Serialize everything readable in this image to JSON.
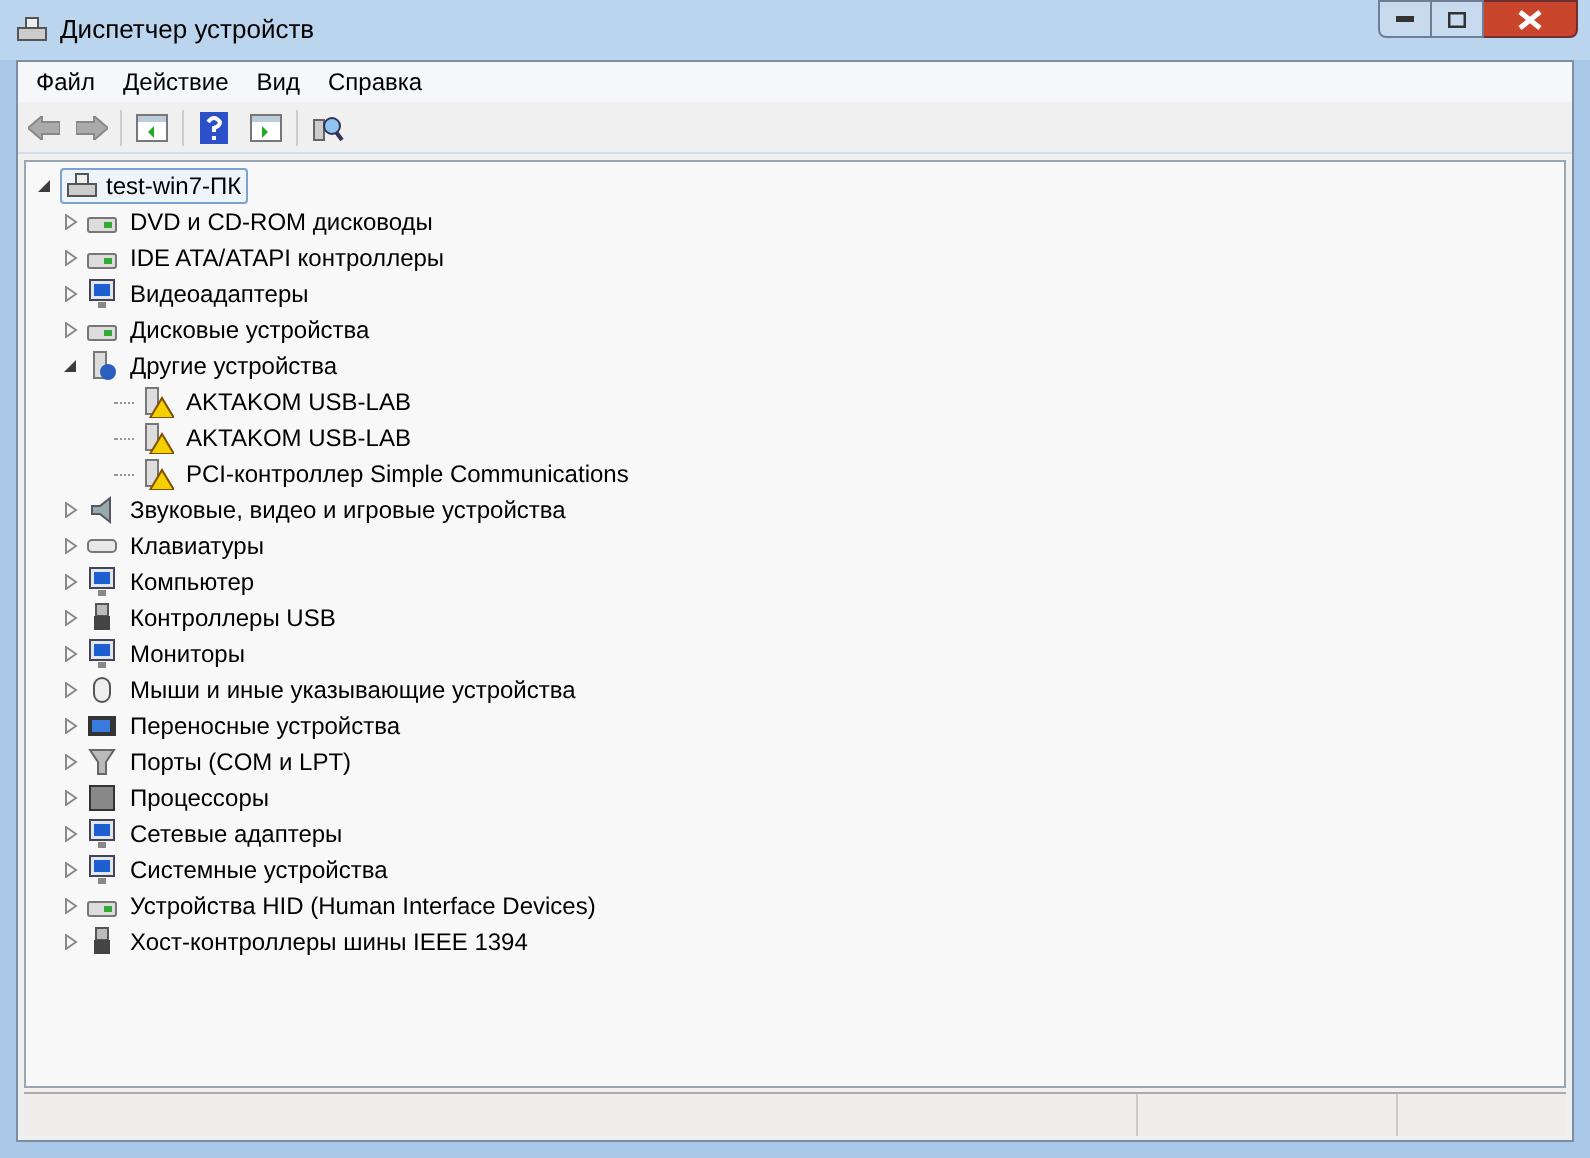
{
  "window": {
    "title": "Диспетчер устройств"
  },
  "menu": [
    {
      "label": "Файл"
    },
    {
      "label": "Действие"
    },
    {
      "label": "Вид"
    },
    {
      "label": "Справка"
    }
  ],
  "tree": {
    "root": {
      "label": "test-win7-ПК",
      "expanded": true,
      "selected": true
    },
    "categories": [
      {
        "label": "DVD и CD-ROM дисководы",
        "expanded": false
      },
      {
        "label": "IDE ATA/ATAPI контроллеры",
        "expanded": false
      },
      {
        "label": "Видеоадаптеры",
        "expanded": false
      },
      {
        "label": "Дисковые устройства",
        "expanded": false
      },
      {
        "label": "Другие устройства",
        "expanded": true,
        "children": [
          {
            "label": "AKTAKOM USB-LAB",
            "warning": true
          },
          {
            "label": "AKTAKOM USB-LAB",
            "warning": true
          },
          {
            "label": "PCI-контроллер Simple Communications",
            "warning": true
          }
        ]
      },
      {
        "label": "Звуковые, видео и игровые устройства",
        "expanded": false
      },
      {
        "label": "Клавиатуры",
        "expanded": false
      },
      {
        "label": "Компьютер",
        "expanded": false
      },
      {
        "label": "Контроллеры USB",
        "expanded": false
      },
      {
        "label": "Мониторы",
        "expanded": false
      },
      {
        "label": "Мыши и иные указывающие устройства",
        "expanded": false
      },
      {
        "label": "Переносные устройства",
        "expanded": false
      },
      {
        "label": "Порты (COM и LPT)",
        "expanded": false
      },
      {
        "label": "Процессоры",
        "expanded": false
      },
      {
        "label": "Сетевые адаптеры",
        "expanded": false
      },
      {
        "label": "Системные устройства",
        "expanded": false
      },
      {
        "label": "Устройства HID (Human Interface Devices)",
        "expanded": false
      },
      {
        "label": "Хост-контроллеры шины IEEE 1394",
        "expanded": false
      }
    ]
  }
}
